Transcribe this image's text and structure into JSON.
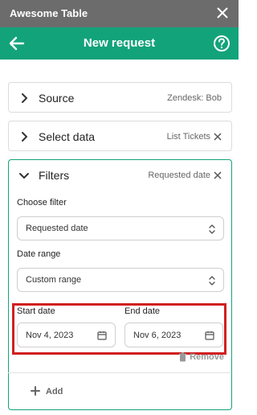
{
  "app": {
    "title": "Awesome Table"
  },
  "header": {
    "title": "New request"
  },
  "cards": {
    "source": {
      "label": "Source",
      "value": "Zendesk: Bob"
    },
    "select_data": {
      "label": "Select data",
      "value": "List Tickets"
    },
    "filters": {
      "label": "Filters",
      "value": "Requested date"
    }
  },
  "filters": {
    "choose_filter_label": "Choose filter",
    "choose_filter_value": "Requested date",
    "date_range_label": "Date range",
    "date_range_value": "Custom range",
    "start_date_label": "Start date",
    "start_date_value": "Nov 4, 2023",
    "end_date_label": "End date",
    "end_date_value": "Nov 6, 2023",
    "remove_label": "Remove",
    "add_label": "Add"
  },
  "colors": {
    "accent": "#13a37b",
    "titlebar": "#6c6c6c",
    "highlight": "#d21f1f"
  }
}
